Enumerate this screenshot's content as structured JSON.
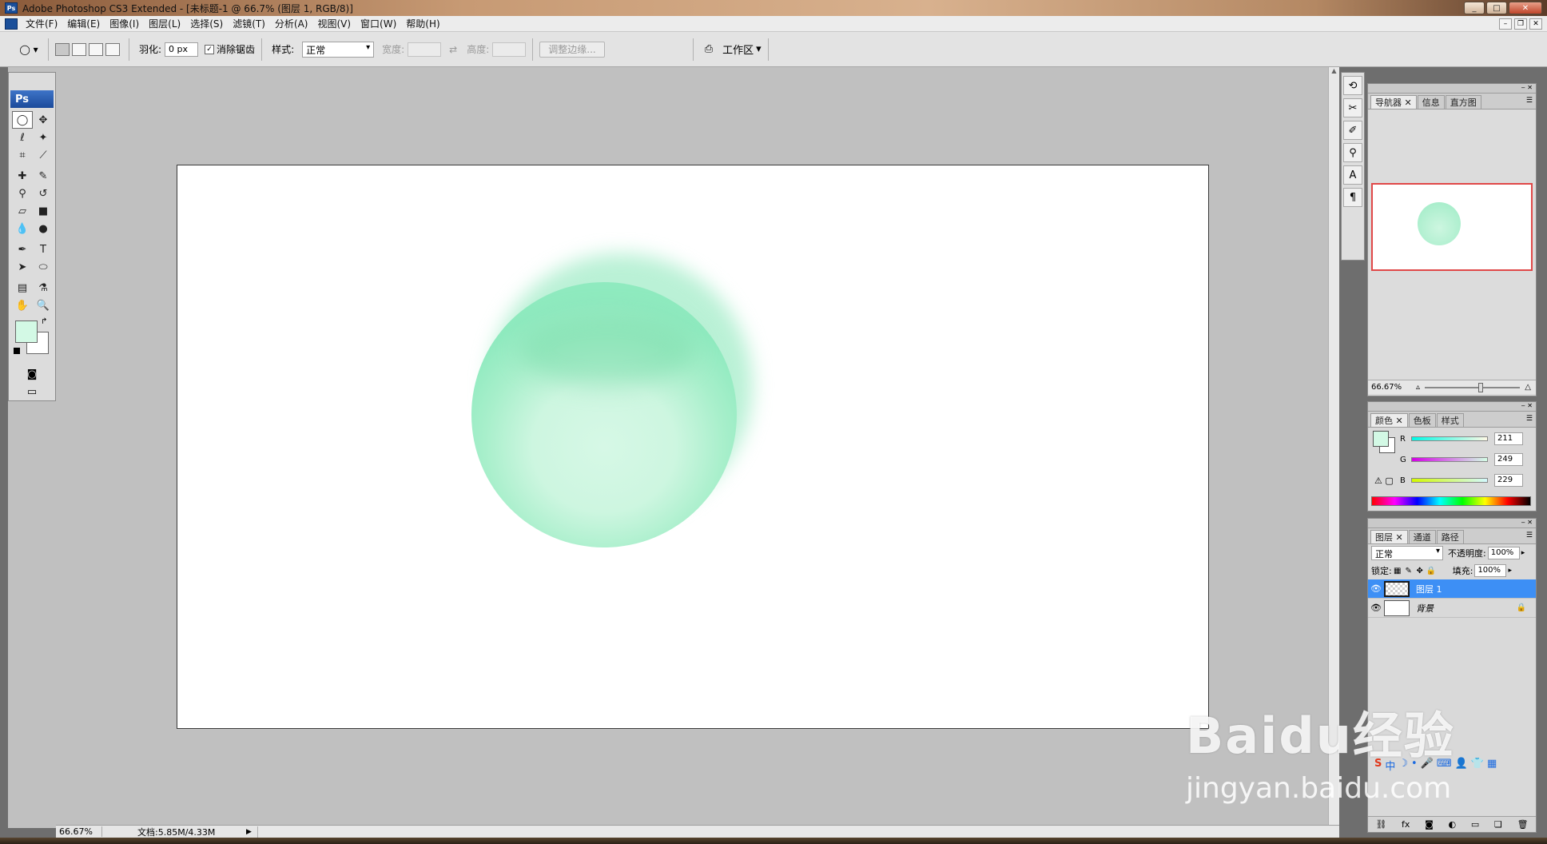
{
  "titlebar": {
    "title": "Adobe Photoshop CS3 Extended - [未标题-1 @ 66.7% (图层 1, RGB/8)]",
    "ps_badge": "Ps",
    "minimize": "_",
    "maximize": "□",
    "close": "✕"
  },
  "menubar": {
    "items": [
      "文件(F)",
      "编辑(E)",
      "图像(I)",
      "图层(L)",
      "选择(S)",
      "滤镜(T)",
      "分析(A)",
      "视图(V)",
      "窗口(W)",
      "帮助(H)"
    ]
  },
  "options": {
    "feather_label": "羽化:",
    "feather_value": "0 px",
    "antialias_label": "消除锯齿",
    "antialias_checked": true,
    "style_label": "样式:",
    "style_value": "正常",
    "width_label": "宽度:",
    "height_label": "高度:",
    "refine_edge": "调整边缘...",
    "workspace": "工作区"
  },
  "tools": {
    "ps_logo": "Ps",
    "foreground_color": "#d3f9e5",
    "background_color": "#ffffff"
  },
  "statusbar": {
    "zoom": "66.67%",
    "docinfo": "文档:5.85M/4.33M"
  },
  "navigator": {
    "tabs": [
      "导航器",
      "信息",
      "直方图"
    ],
    "zoom": "66.67%"
  },
  "color": {
    "tabs": [
      "颜色",
      "色板",
      "样式"
    ],
    "r_label": "R",
    "r": "211",
    "g_label": "G",
    "g": "249",
    "b_label": "B",
    "b": "229"
  },
  "layers": {
    "tabs": [
      "图层",
      "通道",
      "路径"
    ],
    "blend_mode": "正常",
    "opacity_label": "不透明度:",
    "opacity": "100%",
    "lock_label": "锁定:",
    "fill_label": "填充:",
    "fill": "100%",
    "items": [
      {
        "name": "图层 1",
        "selected": true
      },
      {
        "name": "背景",
        "selected": false
      }
    ]
  },
  "watermark": {
    "logo": "Baidu经验",
    "url": "jingyan.baidu.com"
  },
  "ime": {
    "label": "中"
  }
}
